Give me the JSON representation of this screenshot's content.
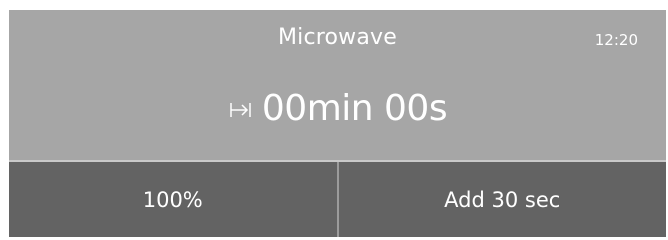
{
  "header": {
    "title": "Microwave",
    "clock": "12:20"
  },
  "timer": {
    "icon": "timer-end-icon",
    "value": "00min 00s"
  },
  "footer": {
    "power_label": "100%",
    "add_time_label": "Add 30 sec"
  },
  "colors": {
    "header_bg": "#a6a6a6",
    "button_bg": "#636363",
    "text": "#ffffff"
  }
}
